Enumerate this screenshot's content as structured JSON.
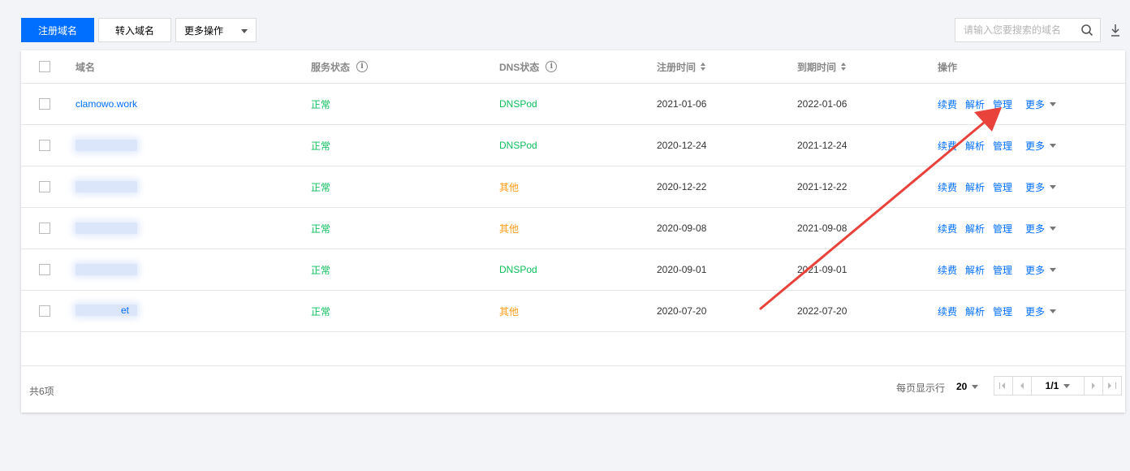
{
  "toolbar": {
    "register_label": "注册域名",
    "transfer_label": "转入域名",
    "more_actions_label": "更多操作",
    "search_placeholder": "请输入您要搜索的域名"
  },
  "table": {
    "headers": {
      "domain": "域名",
      "service_status": "服务状态",
      "dns_status": "DNS状态",
      "register_time": "注册时间",
      "expire_time": "到期时间",
      "actions": "操作"
    },
    "rows": [
      {
        "domain": "clamowo.work",
        "service": "正常",
        "dns": "DNSPod",
        "dns_color": "#0abf5b",
        "registered": "2021-01-06",
        "expires": "2022-01-06"
      },
      {
        "domain": "",
        "service": "正常",
        "dns": "DNSPod",
        "dns_color": "#0abf5b",
        "registered": "2020-12-24",
        "expires": "2021-12-24"
      },
      {
        "domain": "",
        "service": "正常",
        "dns": "其他",
        "dns_color": "#ff9c19",
        "registered": "2020-12-22",
        "expires": "2021-12-22"
      },
      {
        "domain": "",
        "service": "正常",
        "dns": "其他",
        "dns_color": "#ff9c19",
        "registered": "2020-09-08",
        "expires": "2021-09-08"
      },
      {
        "domain": "",
        "service": "正常",
        "dns": "DNSPod",
        "dns_color": "#0abf5b",
        "registered": "2020-09-01",
        "expires": "2021-09-01"
      },
      {
        "domain": "et",
        "service": "正常",
        "dns": "其他",
        "dns_color": "#ff9c19",
        "registered": "2020-07-20",
        "expires": "2022-07-20"
      }
    ],
    "row_actions": {
      "renew": "续费",
      "resolve": "解析",
      "manage": "管理",
      "more": "更多"
    }
  },
  "footer": {
    "total": "共6项",
    "per_page_label": "每页显示行",
    "per_page_value": "20",
    "page_indicator": "1/1"
  },
  "colors": {
    "primary": "#006eff",
    "success": "#0abf5b",
    "warning": "#ff9c19",
    "annotation_arrow": "#e8423a"
  }
}
